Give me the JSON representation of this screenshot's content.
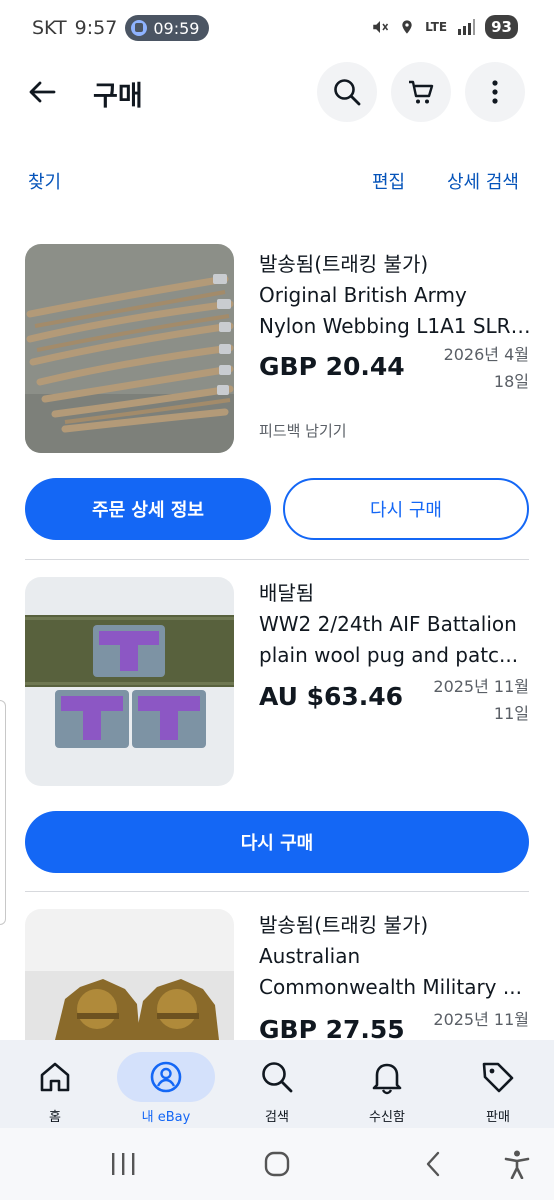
{
  "status_bar": {
    "carrier": "SKT",
    "time": "9:57",
    "pill_time": "09:59",
    "network": "LTE",
    "battery": "93"
  },
  "app_bar": {
    "title": "구매",
    "icons": [
      "back-arrow-icon",
      "search-icon",
      "cart-icon",
      "more-vertical-icon"
    ]
  },
  "links": {
    "find": "찾기",
    "edit": "편집",
    "advanced_search": "상세 검색"
  },
  "orders": [
    {
      "status": "발송됨(트래킹 불가)",
      "title_line1": "Original British Army",
      "title_line2": "Nylon Webbing L1A1 SLR ...",
      "price": "GBP 20.44",
      "date_line1": "2026년 4월",
      "date_line2": "18일",
      "feedback": "피드백 남기기",
      "primary_button": "주문 상세 정보",
      "secondary_button": "다시 구매"
    },
    {
      "status": "배달됨",
      "title_line1": "WW2 2/24th AIF Battalion",
      "title_line2": "plain wool  pug and patc...",
      "price": "AU $63.46",
      "date_line1": "2025년 11월",
      "date_line2": "11일",
      "primary_button": "다시 구매"
    },
    {
      "status": "발송됨(트래킹 불가)",
      "title_line1": "Australian",
      "title_line2": "Commonwealth Military ...",
      "price": "GBP 27.55",
      "date_line1": "2025년 11월"
    }
  ],
  "bottom_nav": [
    {
      "label": "홈",
      "icon": "home-icon"
    },
    {
      "label": "내 eBay",
      "icon": "profile-icon"
    },
    {
      "label": "검색",
      "icon": "search-icon"
    },
    {
      "label": "수신함",
      "icon": "bell-icon"
    },
    {
      "label": "판매",
      "icon": "tag-icon"
    }
  ],
  "colors": {
    "accent": "#1467f5",
    "link": "#0654ba",
    "text": "#111820",
    "muted": "#5a5f66"
  }
}
